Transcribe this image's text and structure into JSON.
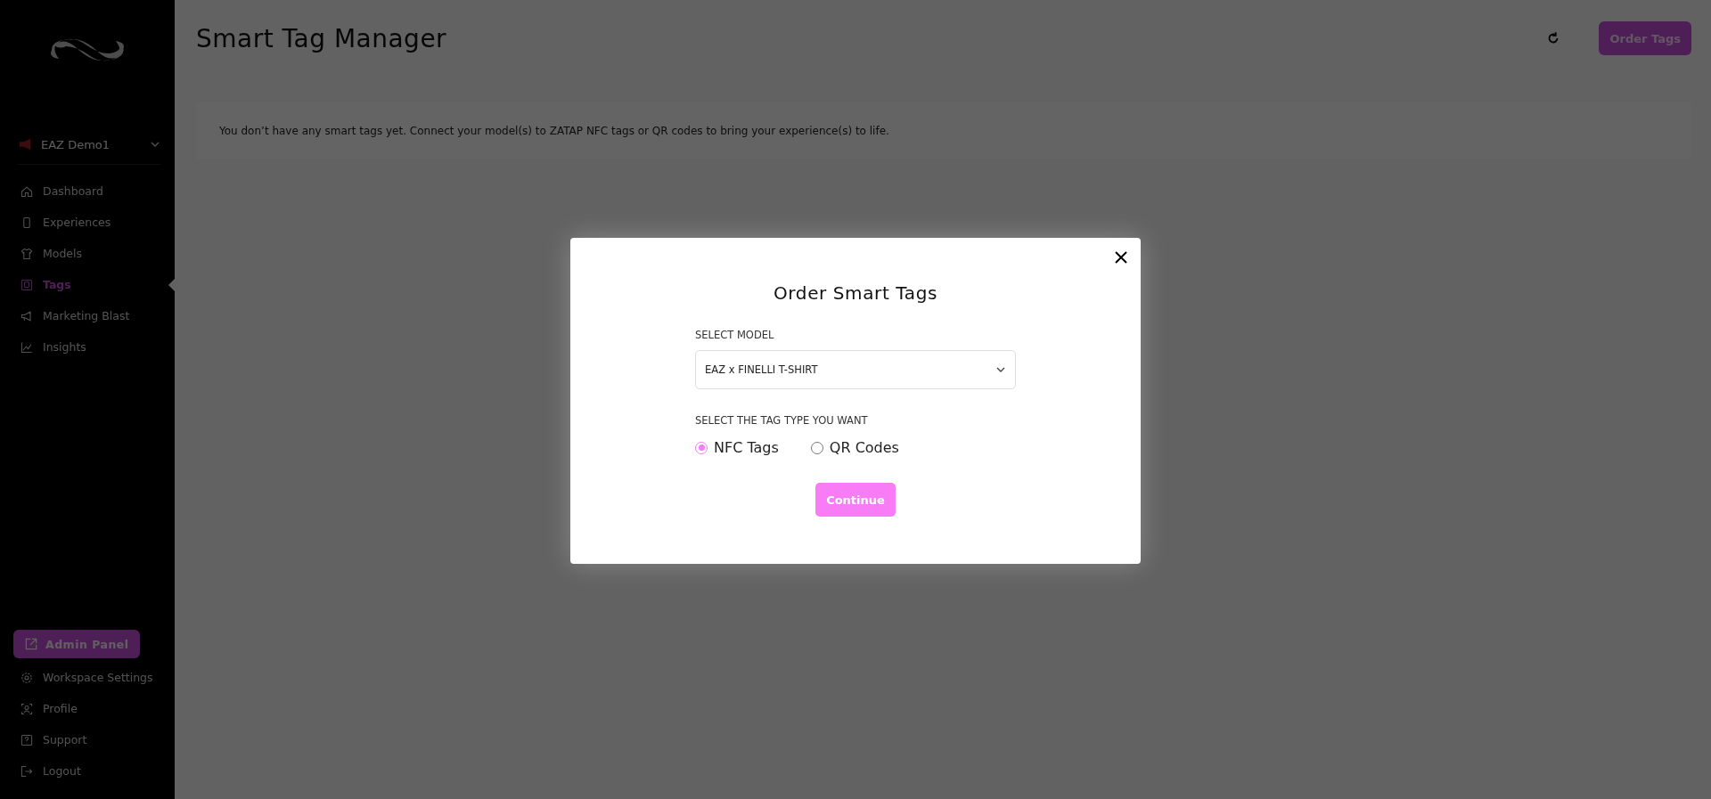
{
  "sidebar": {
    "workspace": {
      "name": "EAZ Demo1"
    },
    "nav": [
      {
        "label": "Dashboard",
        "selected": false
      },
      {
        "label": "Experiences",
        "selected": false
      },
      {
        "label": "Models",
        "selected": false
      },
      {
        "label": "Tags",
        "selected": true
      },
      {
        "label": "Marketing Blast",
        "selected": false
      },
      {
        "label": "Insights",
        "selected": false
      }
    ],
    "admin_button": "Admin Panel",
    "footer": [
      {
        "label": "Workspace Settings"
      },
      {
        "label": "Profile"
      },
      {
        "label": "Support"
      },
      {
        "label": "Logout"
      }
    ]
  },
  "header": {
    "title": "Smart Tag Manager",
    "order_button": "Order Tags"
  },
  "notice": "You don’t have any smart tags yet. Connect your model(s) to ZATAP NFC tags or QR codes to bring your experience(s) to life.",
  "modal": {
    "title": "Order Smart Tags",
    "model_label": "SELECT MODEL",
    "model_value": "EAZ x FINELLI T-SHIRT",
    "type_label": "SELECT THE TAG TYPE YOU WANT",
    "options": [
      {
        "label": "NFC Tags",
        "selected": true
      },
      {
        "label": "QR Codes",
        "selected": false
      }
    ],
    "continue_button": "Continue"
  }
}
